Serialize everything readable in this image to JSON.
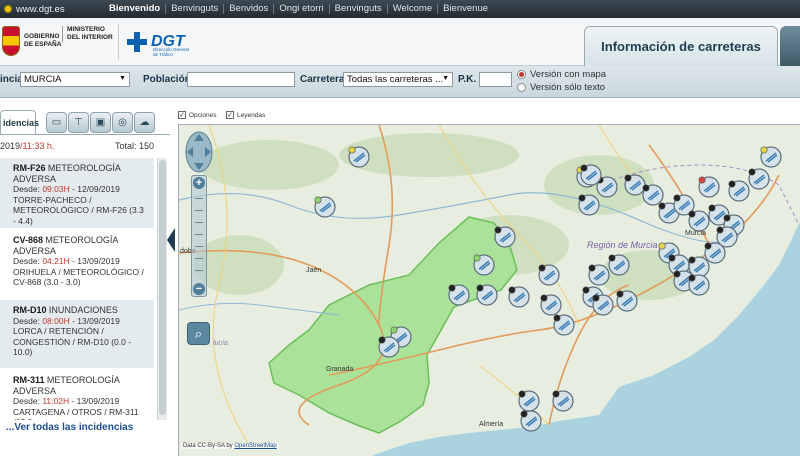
{
  "topnav": {
    "site": "www.dgt.es",
    "languages": [
      "Bienvenido",
      "Benvinguts",
      "Benvidos",
      "Ongi etorri",
      "Benvinguts",
      "Welcome",
      "Bienvenue"
    ]
  },
  "header": {
    "gov_line1": "GOBIERNO",
    "gov_line2": "DE ESPAÑA",
    "ministry_line1": "MINISTERIO",
    "ministry_line2": "DEL INTERIOR",
    "dgt_logo": "DGT",
    "dgt_sub1": "Dirección General",
    "dgt_sub2": "de Tráfico",
    "active_tab": "Información de carreteras"
  },
  "filters": {
    "province_label": "incia",
    "province_value": "MURCIA",
    "population_label": "Población",
    "population_value": "",
    "road_label": "Carretera",
    "road_value": "Todas las carreteras ...",
    "pk_label": "P.K.",
    "pk_value": "",
    "radio_map": "Versión con mapa",
    "radio_text": "Versión sólo texto"
  },
  "panel": {
    "tab_label": "idencias",
    "tab_icons": [
      "camera-icon",
      "sign-icon",
      "panel-icon",
      "radio-icon",
      "weather-icon"
    ],
    "date": "2019",
    "time": "/11:33 h.",
    "total": "Total: 150",
    "see_all": "...Ver todas las incidencias",
    "incidents": [
      {
        "code": "RM-F26",
        "type": "METEOROLOGÍA",
        "type2": "ADVERSA",
        "since_label": "Desde:",
        "since_time": "09:03H",
        "since_date": "- 12/09/2019",
        "desc": "TORRE-PACHECO / METEOROLÓGICO / RM-F26 (3.3 - 4.4)"
      },
      {
        "code": "CV-868",
        "type": "METEOROLOGÍA",
        "type2": "ADVERSA",
        "since_label": "Desde:",
        "since_time": "04:21H",
        "since_date": "- 13/09/2019",
        "desc": "ORIHUELA / METEOROLÓGICO / CV-868 (3.0 - 3.0)"
      },
      {
        "code": "RM-D10",
        "type": "INUNDACIONES",
        "type2": "",
        "since_label": "Desde:",
        "since_time": "08:00H",
        "since_date": "- 13/09/2019",
        "desc": "LORCA / RETENCIÓN / CONGESTIÓN / RM-D10 (0.0 - 10.0)"
      },
      {
        "code": "RM-311",
        "type": "METEOROLOGÍA",
        "type2": "ADVERSA",
        "since_label": "Desde:",
        "since_time": "11:02H",
        "since_date": "- 13/09/2019",
        "desc": "CARTAGENA / OTROS / RM-311 (13.0 -"
      }
    ]
  },
  "map": {
    "option_1": "Opciones",
    "option_2": "Leyendas",
    "region_label": "Región de Murcia",
    "labels": {
      "murcia": "Murcia",
      "jaen": "Jaén",
      "granada": "Granada",
      "almeria": "Almería",
      "cordoba": "doba",
      "lucia": "lucía"
    },
    "attribution_pre": "Data CC-By-SA by",
    "attribution_link": "OpenStreetMap",
    "colors": {
      "land": "#e7eee0",
      "highlight": "#a9e298",
      "sea": "#aad3df",
      "marker": "#d6e2ea"
    }
  }
}
